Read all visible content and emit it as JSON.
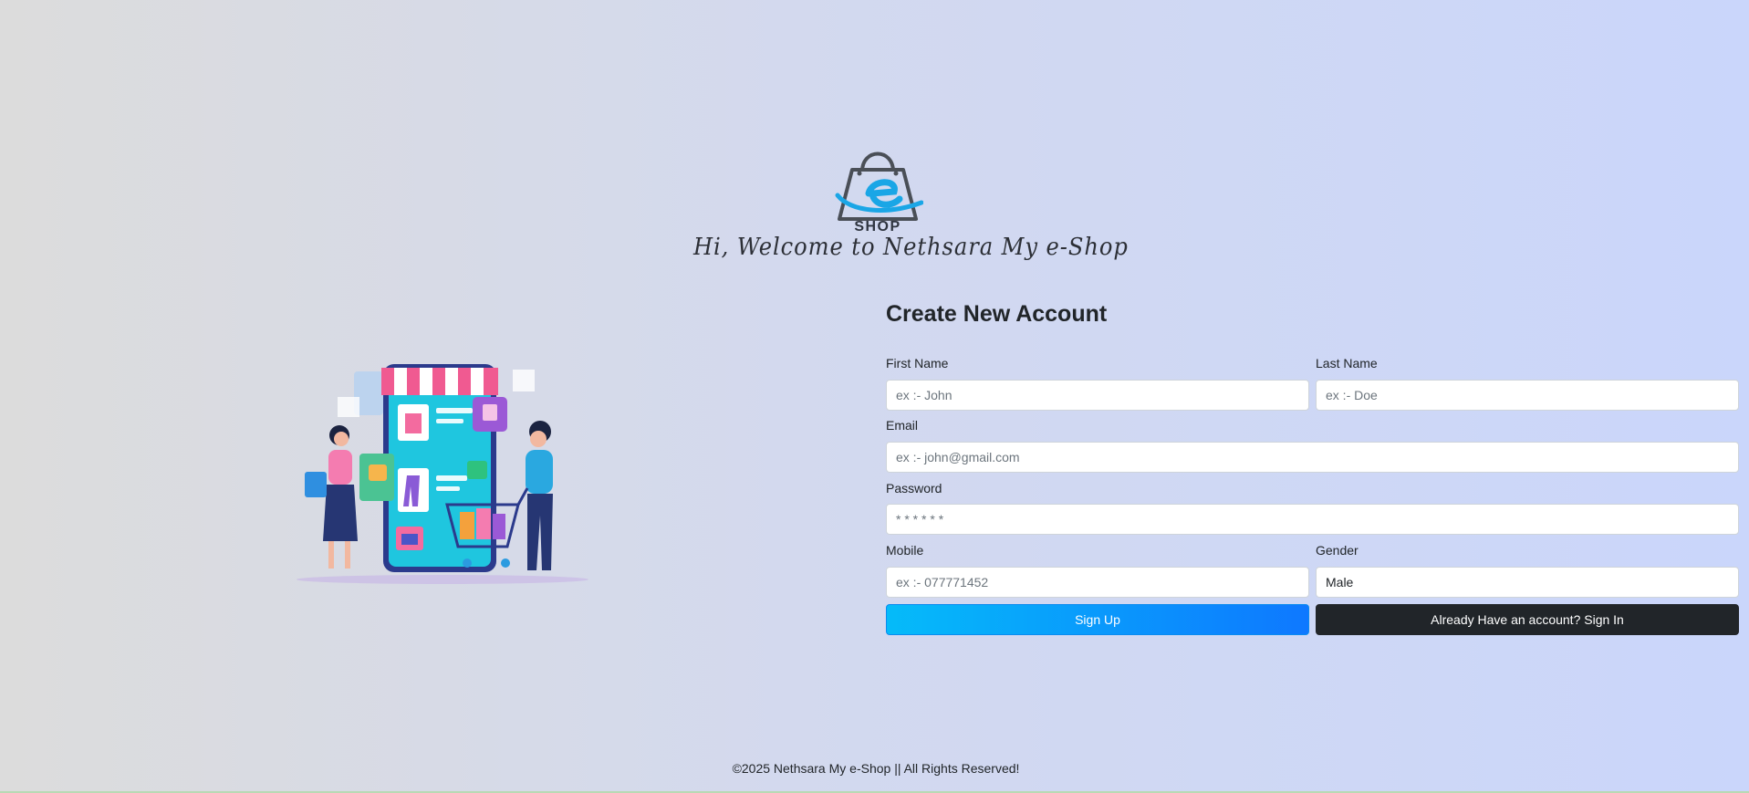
{
  "brand": {
    "logo_text": "SHOP",
    "welcome": "Hi, Welcome to Nethsara My e-Shop"
  },
  "form": {
    "title": "Create New Account",
    "first_name": {
      "label": "First Name",
      "placeholder": "ex :- John",
      "value": ""
    },
    "last_name": {
      "label": "Last Name",
      "placeholder": "ex :- Doe",
      "value": ""
    },
    "email": {
      "label": "Email",
      "placeholder": "ex :- john@gmail.com",
      "value": ""
    },
    "password": {
      "label": "Password",
      "placeholder": "* * * * * *",
      "value": ""
    },
    "mobile": {
      "label": "Mobile",
      "placeholder": "ex :- 077771452",
      "value": ""
    },
    "gender": {
      "label": "Gender",
      "selected": "Male"
    },
    "signup_label": "Sign Up",
    "signin_label": "Already Have an account? Sign In"
  },
  "footer": {
    "text": "©2025 Nethsara My e-Shop || All Rights Reserved!"
  },
  "colors": {
    "signup_gradient_start": "#05bbf9",
    "signup_gradient_end": "#0e78ff",
    "signin_bg": "#212529",
    "logo_accent": "#1aa6e6"
  },
  "icons": {
    "logo": "shopping-bag-e-logo-icon",
    "illustration": "online-shopping-illustration"
  }
}
